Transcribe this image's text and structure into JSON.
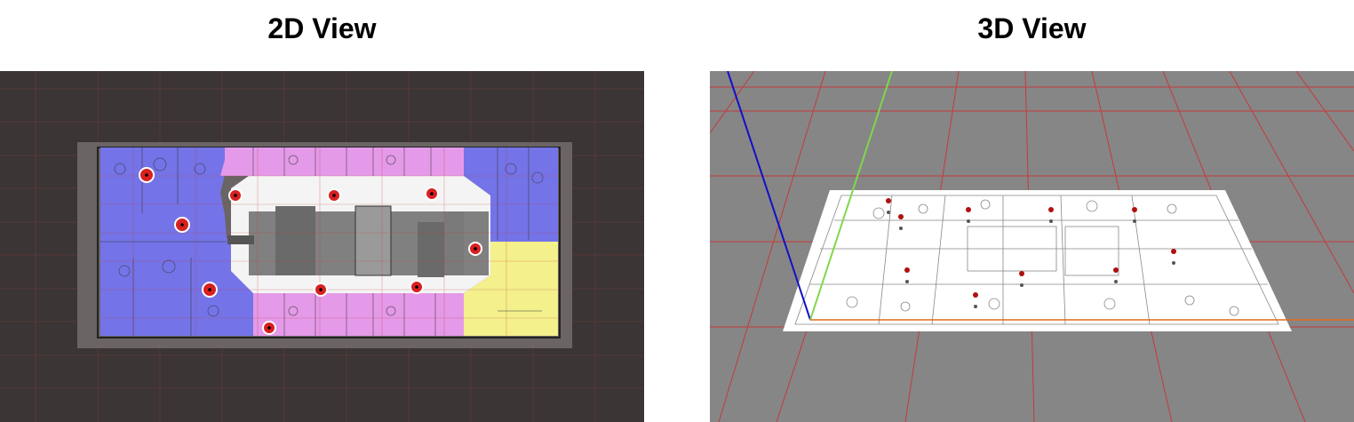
{
  "titles": {
    "view_2d": "2D View",
    "view_3d": "3D View"
  },
  "colors": {
    "background_2d": "#3b3535",
    "background_3d": "#868686",
    "grid_line": "#c43a3a",
    "zone_office": "#7474e8",
    "zone_meeting": "#e49ae8",
    "zone_storage": "#f4f08c",
    "waypoint": "#d82020",
    "axis_x": "#e06a1a",
    "axis_y": "#7ed84a",
    "axis_z": "#1010c8"
  },
  "icons": {
    "waypoint": "waypoint-marker-icon"
  }
}
